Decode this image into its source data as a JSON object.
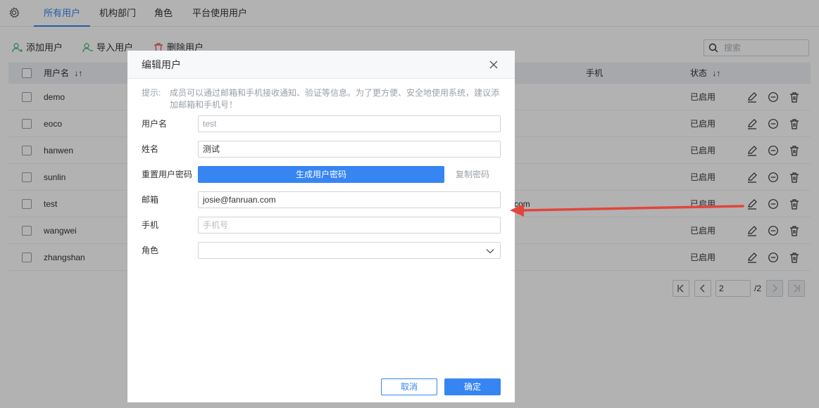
{
  "tabs": [
    {
      "label": "所有用户",
      "active": true
    },
    {
      "label": "机构部门",
      "active": false
    },
    {
      "label": "角色",
      "active": false
    },
    {
      "label": "平台使用用户",
      "active": false
    }
  ],
  "toolbar": {
    "add_user": "添加用户",
    "import_user": "导入用户",
    "delete_user": "删除用户",
    "search_placeholder": "搜索"
  },
  "table": {
    "columns": {
      "username": "用户名",
      "phone": "手机",
      "status": "状态"
    },
    "rows": [
      {
        "username": "demo",
        "extra": "",
        "status": "已启用"
      },
      {
        "username": "eoco",
        "extra": "",
        "status": "已启用"
      },
      {
        "username": "hanwen",
        "extra": "",
        "status": "已启用"
      },
      {
        "username": "sunlin",
        "extra": "",
        "status": "已启用"
      },
      {
        "username": "test",
        "extra": "com",
        "status": "已启用"
      },
      {
        "username": "wangwei",
        "extra": "",
        "status": "已启用"
      },
      {
        "username": "zhangshan",
        "extra": "",
        "status": "已启用"
      }
    ]
  },
  "pagination": {
    "current": "2",
    "total": "/2"
  },
  "dialog": {
    "title": "编辑用户",
    "tip_label": "提示:",
    "tip_text": "成员可以通过邮箱和手机接收通知、验证等信息。为了更方便、安全地使用系统，建议添加邮箱和手机号！",
    "fields": {
      "username_label": "用户名",
      "username_value": "test",
      "name_label": "姓名",
      "name_value": "测试",
      "reset_password_label": "重置用户密码",
      "generate_password_button": "生成用户密码",
      "copy_password_link": "复制密码",
      "email_label": "邮箱",
      "email_value": "josie@fanruan.com",
      "phone_label": "手机",
      "phone_placeholder": "手机号",
      "role_label": "角色",
      "role_value": ""
    },
    "cancel_button": "取消",
    "ok_button": "确定"
  },
  "colors": {
    "accent": "#3685f2",
    "arrow": "#e2453c"
  }
}
